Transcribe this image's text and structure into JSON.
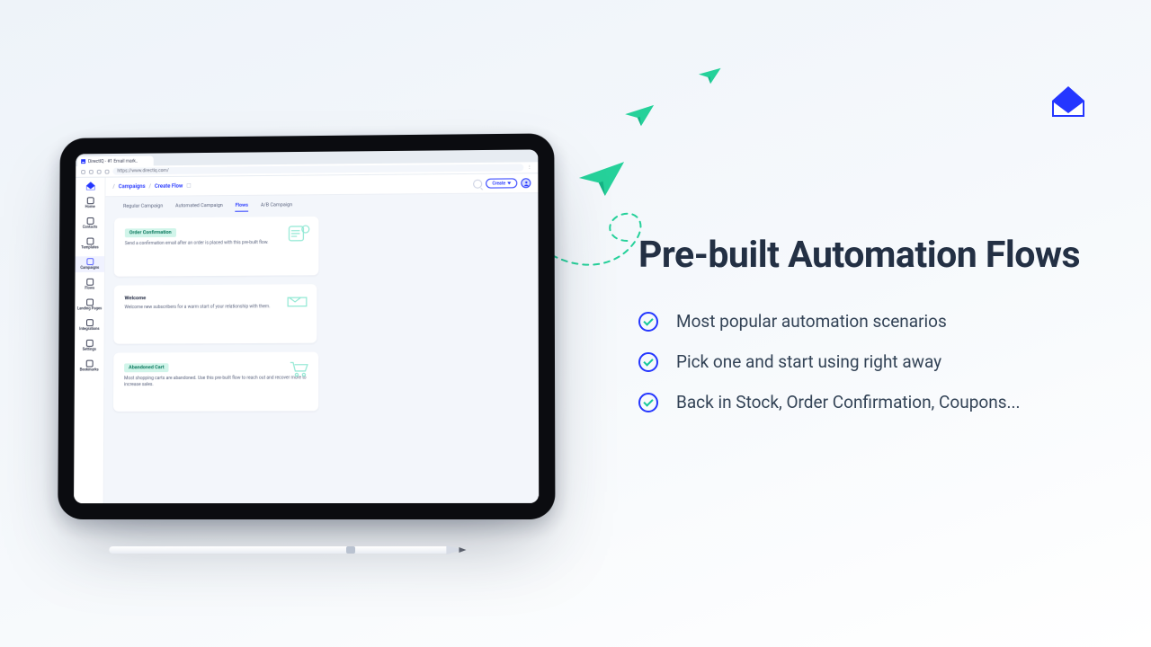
{
  "promo": {
    "headline": "Pre-built Automation Flows",
    "bullets": [
      "Most popular automation scenarios",
      "Pick one and start using right away",
      "Back in Stock, Order Confirmation, Coupons..."
    ]
  },
  "colors": {
    "brand": "#2436ff",
    "accent": "#25d19a",
    "badge_bg": "#d1f5ea",
    "text_dark": "#233044"
  },
  "browser": {
    "tab_title": "DirectIQ - #1 Email mark..",
    "url": "https://www.directiq.com/"
  },
  "app": {
    "breadcrumb": [
      "Campaigns",
      "Create Flow"
    ],
    "topbar": {
      "create_label": "Create"
    },
    "sidebar": [
      {
        "label": "Home",
        "icon": "home-icon",
        "active": false
      },
      {
        "label": "Contacts",
        "icon": "contacts-icon",
        "active": false
      },
      {
        "label": "Templates",
        "icon": "templates-icon",
        "active": false
      },
      {
        "label": "Campaigns",
        "icon": "campaigns-icon",
        "active": true
      },
      {
        "label": "Flows",
        "icon": "flows-icon",
        "active": false
      },
      {
        "label": "Landing Pages",
        "icon": "landing-pages-icon",
        "active": false
      },
      {
        "label": "Integrations",
        "icon": "integrations-icon",
        "active": false
      },
      {
        "label": "Settings",
        "icon": "settings-icon",
        "active": false
      },
      {
        "label": "Bookmarks",
        "icon": "bookmarks-icon",
        "active": false
      }
    ],
    "tabs": [
      {
        "label": "Regular Campaign",
        "active": false
      },
      {
        "label": "Automated Campaign",
        "active": false
      },
      {
        "label": "Flows",
        "active": true
      },
      {
        "label": "A/B Campaign",
        "active": false
      }
    ],
    "flows": [
      {
        "title": "Order Confirmation",
        "desc": "Send a confirmation email after an order is placed with this pre-built flow.",
        "icon": "receipt-icon",
        "highlighted": true
      },
      {
        "title": "Welcome",
        "desc": "Welcome new subscribers for a warm start of your relationship with them.",
        "icon": "handshake-icon",
        "highlighted": false
      },
      {
        "title": "Abandoned Cart",
        "desc": "Most shopping carts are abandoned. Use this pre-built flow to reach out and recover more to increase sales.",
        "icon": "cart-icon",
        "highlighted": true
      }
    ]
  }
}
